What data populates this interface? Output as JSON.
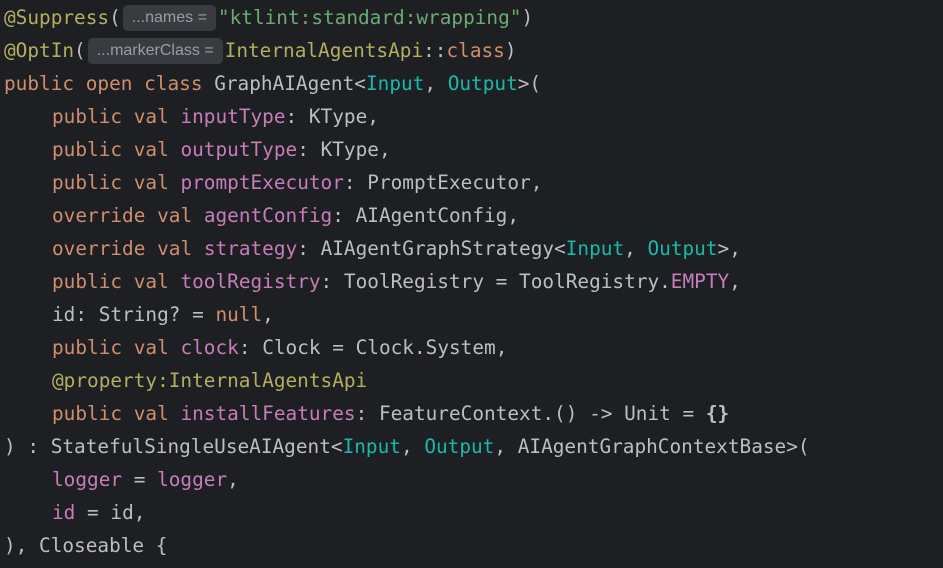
{
  "hints": {
    "names": "...names =",
    "marker_class": "...markerClass ="
  },
  "tok": {
    "suppress_ann": "@Suppress",
    "optin_ann": "@OptIn",
    "paren_open": "(",
    "paren_close": ")",
    "suppress_value": "\"ktlint:standard:wrapping\"",
    "internal_agents_api": "InternalAgentsApi",
    "double_colon": "::",
    "class_kw": "class",
    "public": "public",
    "open": "open",
    "override": "override",
    "val": "val",
    "graph_agent": "GraphAIAgent",
    "lt": "<",
    "gt": ">",
    "comma_sp": ", ",
    "comma": ",",
    "gt_paren": ">(",
    "gt_comma": ">,",
    "input": "Input",
    "output": "Output",
    "input_type": "inputType",
    "output_type": "outputType",
    "prompt_executor": "promptExecutor",
    "agent_config": "agentConfig",
    "strategy": "strategy",
    "tool_registry": "toolRegistry",
    "clock": "clock",
    "install_features": "installFeatures",
    "colon_sp": ": ",
    "eq": " = ",
    "ktype": "KType",
    "prompt_executor_type": "PromptExecutor",
    "agent_config_type": "AIAgentConfig",
    "graph_strategy": "AIAgentGraphStrategy",
    "tool_registry_type": "ToolRegistry",
    "tool_registry_obj": "ToolRegistry.",
    "empty": "EMPTY",
    "id_param": "id: String? = ",
    "null_kw": "null",
    "clock_type": "Clock",
    "clock_system": "Clock.System",
    "property_ann": "@property:",
    "feature_context": "FeatureContext.() -> Unit = ",
    "braces": "{}",
    "close_colon": ") : ",
    "stateful": "StatefulSingleUseAIAgent",
    "context_base": "AIAgentGraphContextBase",
    "logger": "logger",
    "id": "id",
    "closeable": "), Closeable {"
  }
}
